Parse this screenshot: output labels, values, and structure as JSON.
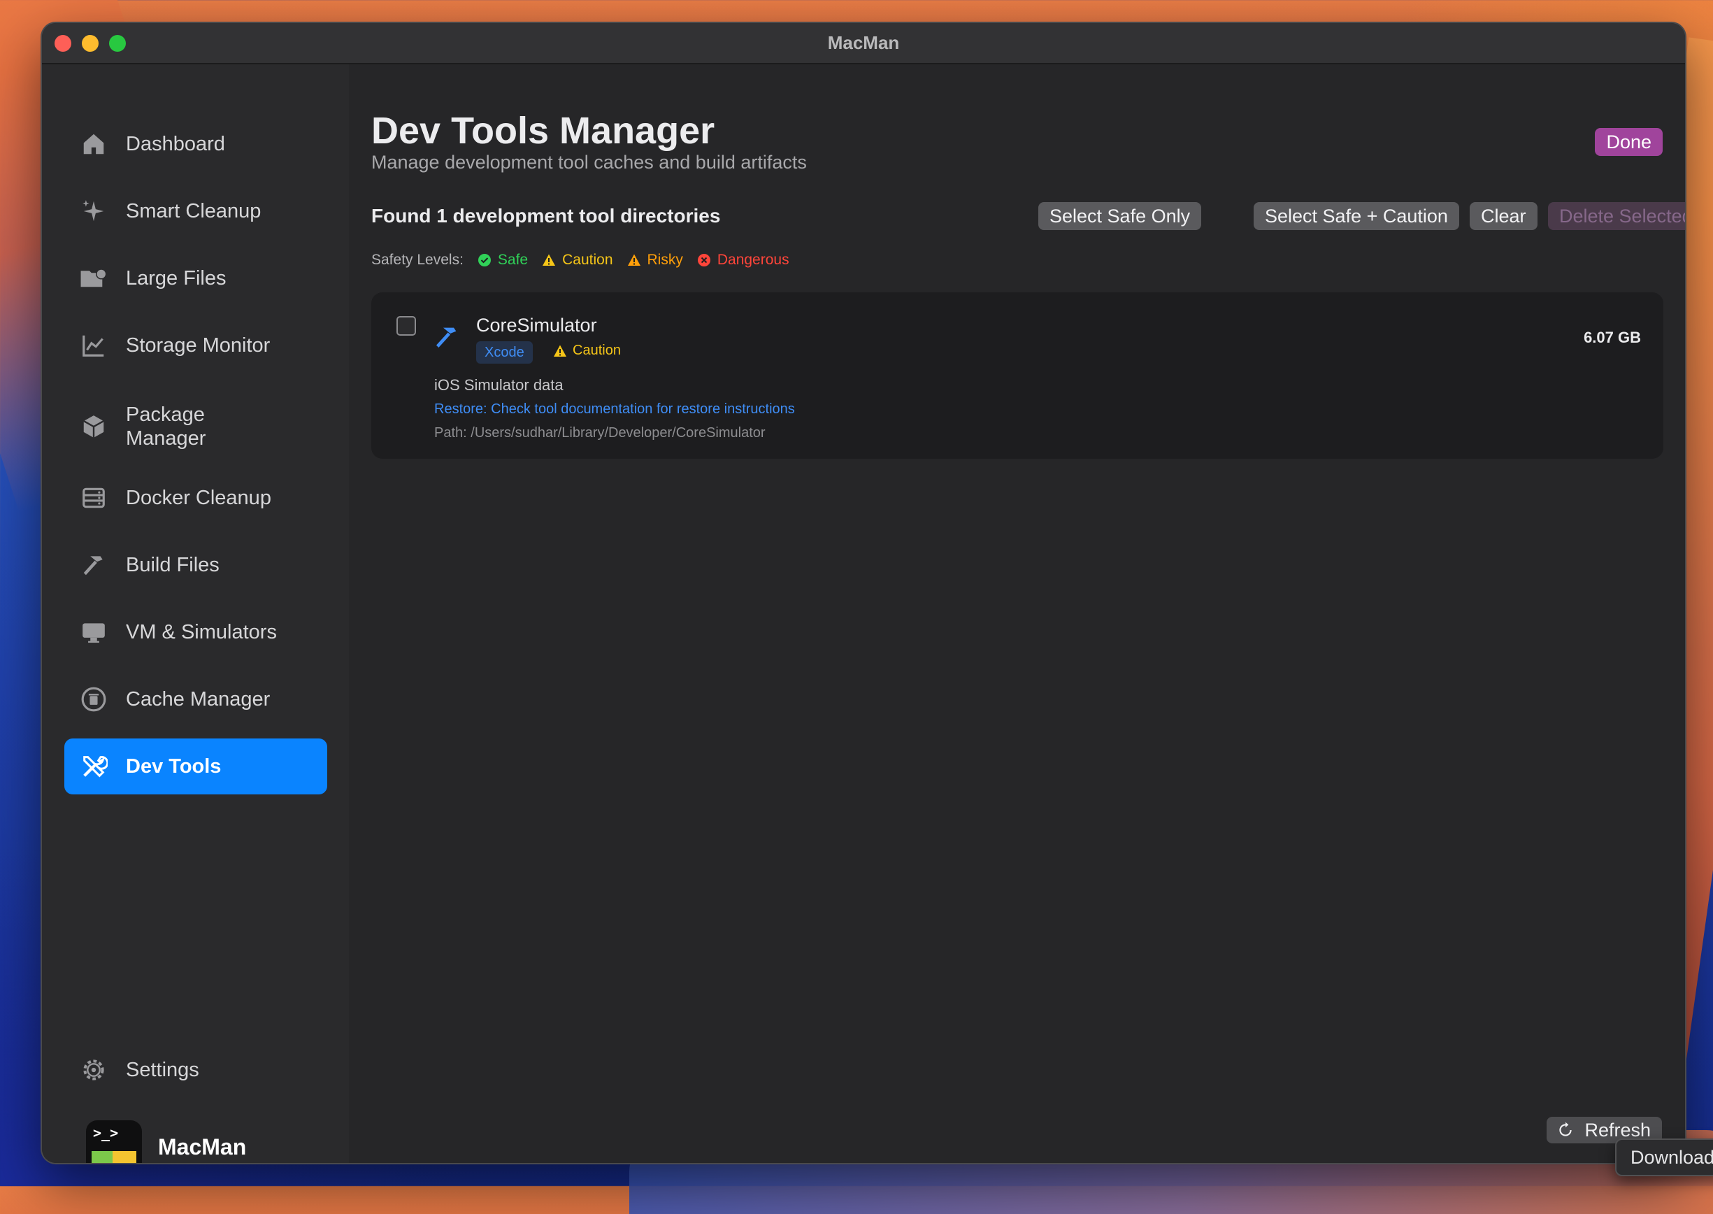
{
  "window": {
    "title": "MacMan"
  },
  "sidebar": {
    "items": [
      {
        "label": "Dashboard",
        "icon": "house-icon"
      },
      {
        "label": "Smart Cleanup",
        "icon": "sparkles-icon"
      },
      {
        "label": "Large Files",
        "icon": "folder-badge-icon"
      },
      {
        "label": "Storage Monitor",
        "icon": "chart-line-icon"
      },
      {
        "label": "Package Manager",
        "icon": "shipping-box-icon"
      },
      {
        "label": "Docker Cleanup",
        "icon": "server-rack-icon"
      },
      {
        "label": "Build Files",
        "icon": "hammer-icon"
      },
      {
        "label": "VM & Simulators",
        "icon": "desktop-computer-icon"
      },
      {
        "label": "Cache Manager",
        "icon": "trash-circle-icon"
      },
      {
        "label": "Dev Tools",
        "icon": "wrench-screwdriver-icon",
        "active": true
      }
    ],
    "settings_label": "Settings",
    "app_name": "MacMan",
    "app_logo_prompt": ">_>"
  },
  "main": {
    "title": "Dev Tools Manager",
    "subtitle": "Manage development tool caches and build artifacts",
    "done_label": "Done",
    "found_text": "Found 1 development tool directories",
    "buttons": {
      "select_safe": "Select Safe Only",
      "select_safe_caution": "Select Safe + Caution",
      "clear": "Clear",
      "delete_selected": "Delete Selected"
    },
    "safety": {
      "label": "Safety Levels:",
      "levels": [
        {
          "name": "Safe",
          "color": "#30d158"
        },
        {
          "name": "Caution",
          "color": "#f5c518"
        },
        {
          "name": "Risky",
          "color": "#ff9f0a"
        },
        {
          "name": "Dangerous",
          "color": "#ff453a"
        }
      ]
    },
    "items": [
      {
        "name": "CoreSimulator",
        "tool": "Xcode",
        "safety": "Caution",
        "description": "iOS Simulator data",
        "restore": "Restore: Check tool documentation for restore instructions",
        "path": "Path: /Users/sudhar/Library/Developer/CoreSimulator",
        "size": "6.07 GB",
        "checked": false
      }
    ],
    "refresh_label": "Refresh"
  },
  "tooltip": "Download"
}
